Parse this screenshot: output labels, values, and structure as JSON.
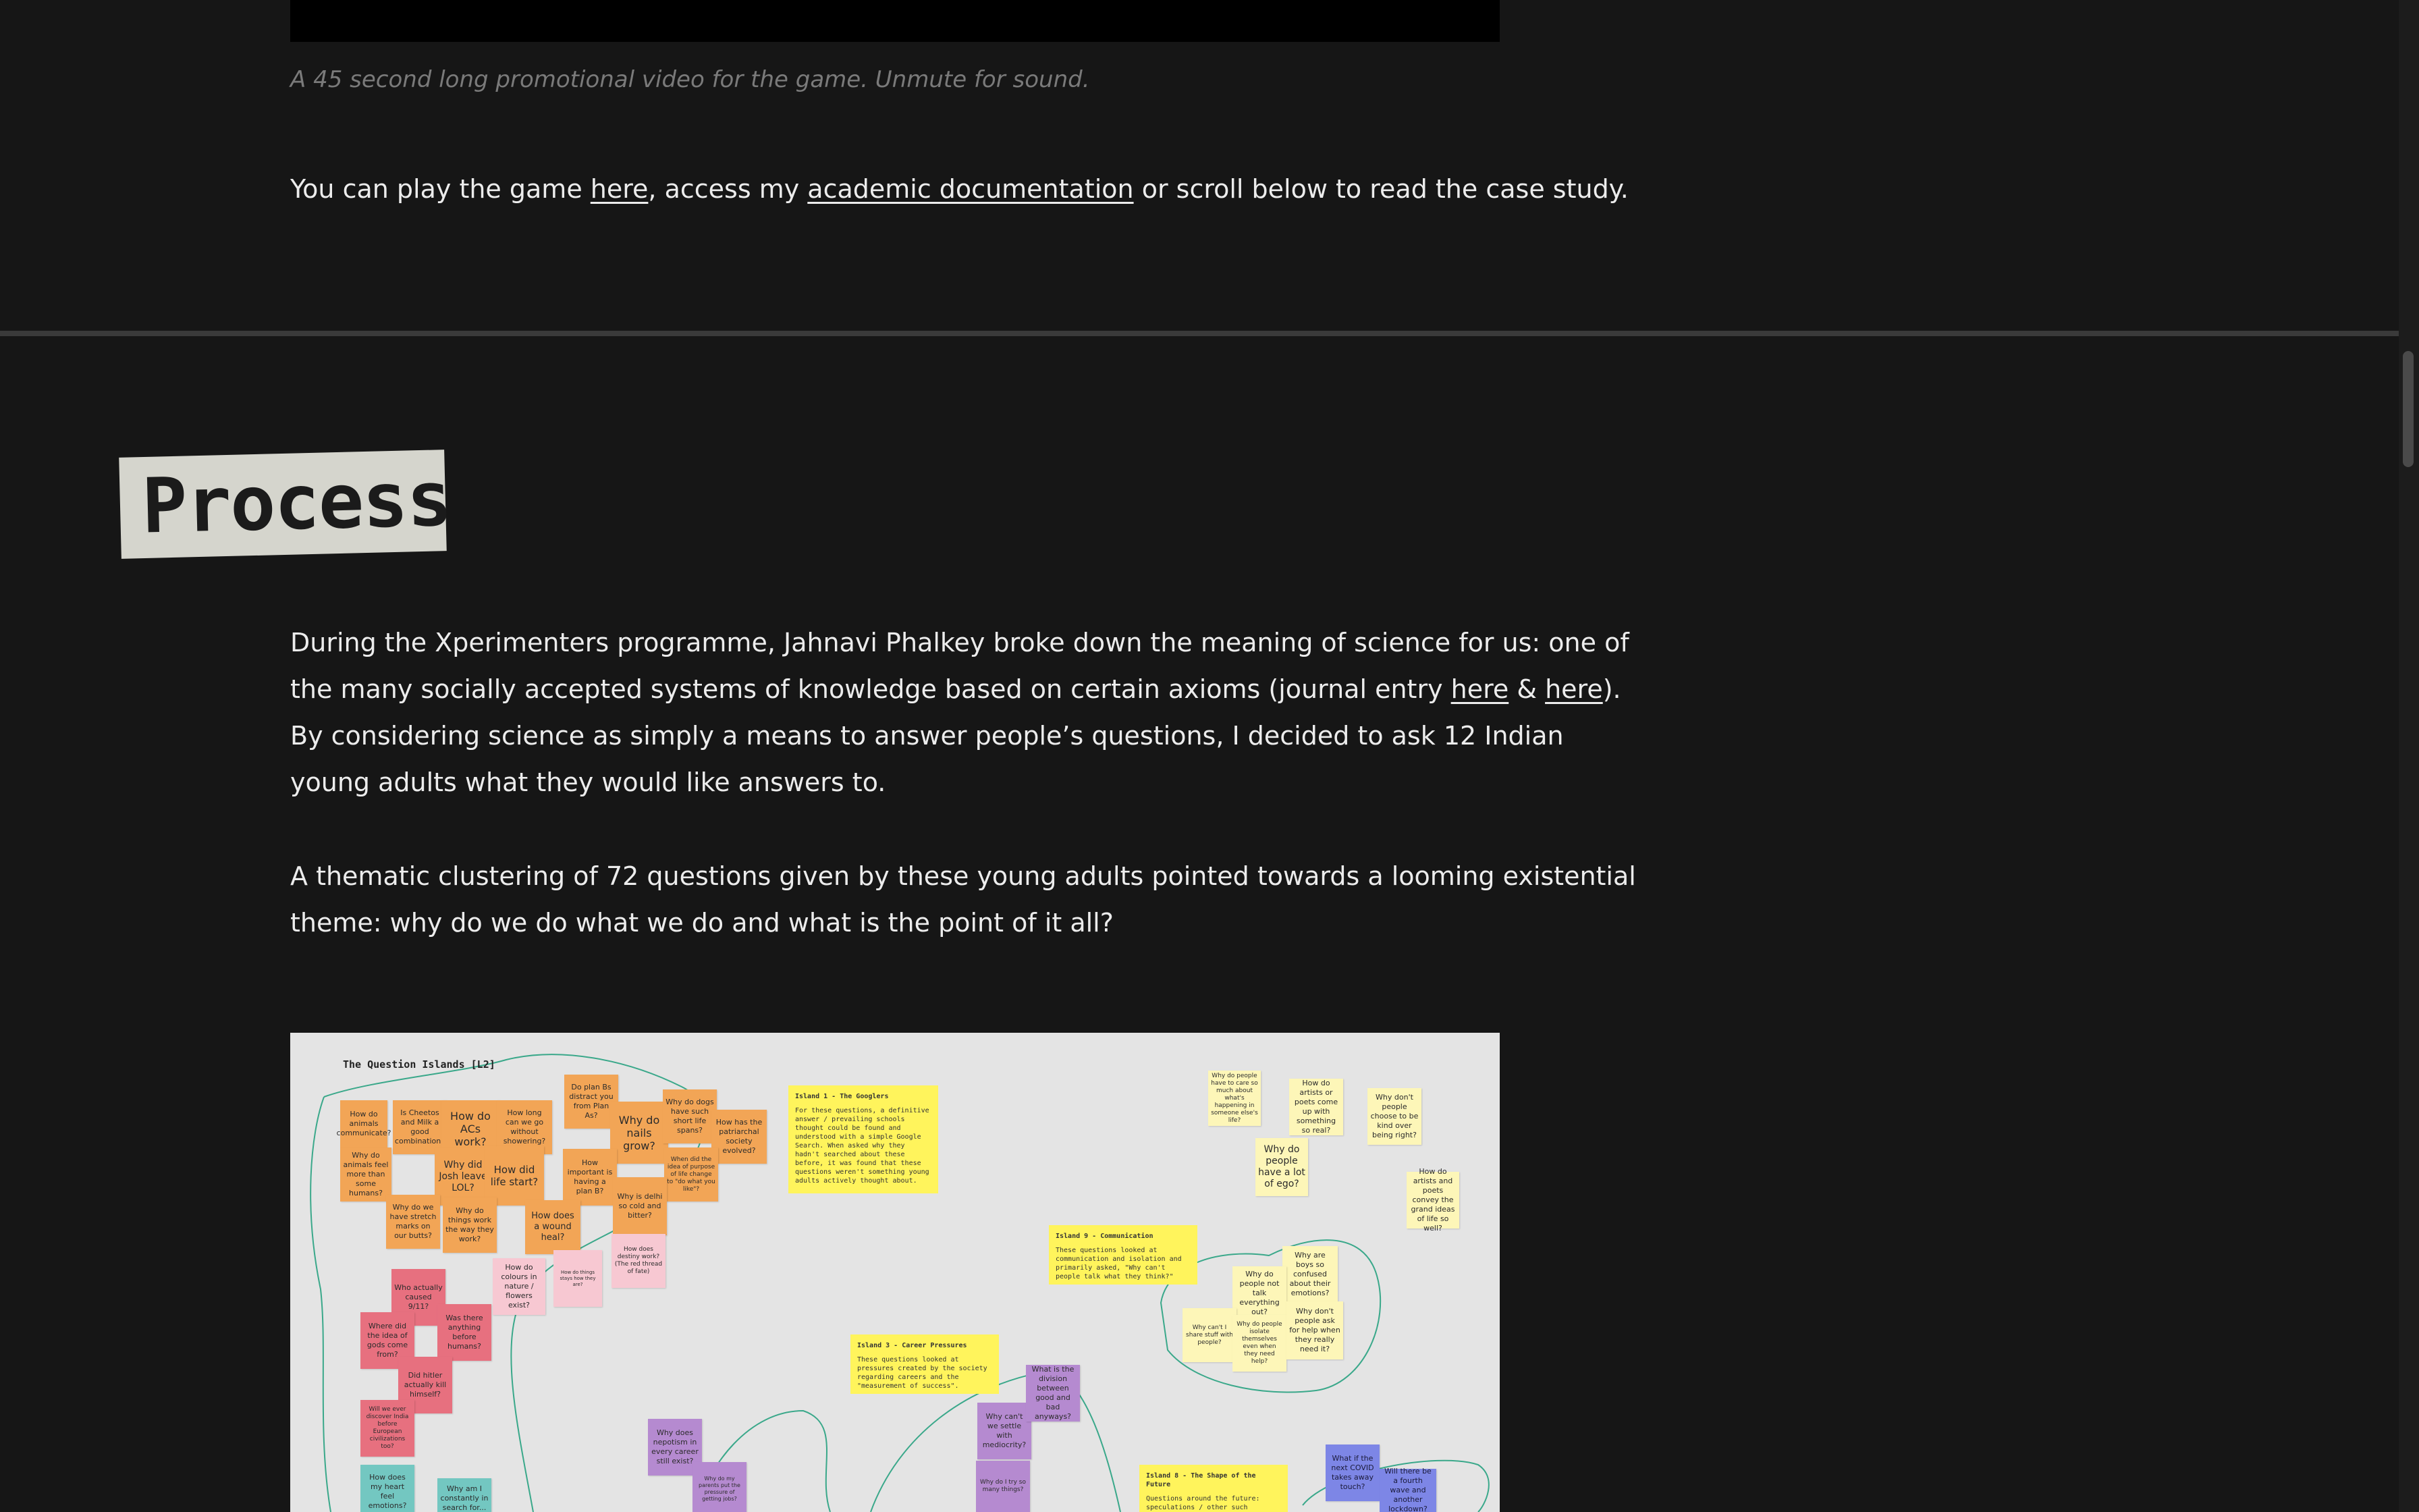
{
  "video": {
    "caption": "A 45 second long promotional video for the game. Unmute for sound."
  },
  "intro": {
    "before": "You can play the game ",
    "link1": "here",
    "middle": ", access my ",
    "link2": "academic documentation",
    "after": " or scroll below to read the case study."
  },
  "process": {
    "heading": "Process",
    "p1_a": "During the Xperimenters programme, Jahnavi Phalkey broke down the meaning of science for us: one of the many socially accepted systems of knowledge based on certain axioms (journal entry ",
    "p1_link1": "here",
    "p1_amp": " & ",
    "p1_link2": "here",
    "p1_b": "). By considering science as simply a means to answer people’s questions, I decided to ask 12 Indian young adults what they would like answers to.",
    "p2": "A thematic clustering of 72 questions given by these young adults pointed towards a looming existential theme: why do we do what we do and what is the point of it all?"
  },
  "board": {
    "title": "The Question Islands [L2]",
    "island1_title": "Island 1 - The Googlers",
    "island1_text": "For these questions, a definitive answer / prevailing schools thought could be found and understood with a simple Google Search. When asked why they hadn't searched about these before, it was found that these questions weren't something young adults actively thought about.",
    "island9_title": "Island 9 - Communication",
    "island9_text": "These questions looked at communication and isolation and primarily asked, \"Why can't people talk what they think?\"",
    "island3_title": "Island 3 - Career Pressures",
    "island3_text": "These questions looked at pressures created by the society regarding careers and the \"measurement of success\".",
    "island8_title": "Island 8 - The Shape of the Future",
    "island8_text": "Questions around the future: speculations / other such curiosity.",
    "notes": {
      "n1": "How do animals communicate?",
      "n2": "Is Cheetos and Milk a good combination?",
      "n3": "How do ACs work?",
      "n4": "How long can we go without showering?",
      "n5": "Do plan Bs distract you from Plan As?",
      "n6": "Why do nails grow?",
      "n7": "Why do dogs have such short life spans?",
      "n8": "How has the patriarchal society evolved?",
      "n9": "Why do animals feel more than some humans?",
      "n10": "Why did Josh leave LOL?",
      "n11": "How did life start?",
      "n12": "How important is having a plan B?",
      "n13": "When did the idea of purpose of life change to \"do what you like\"?",
      "n14": "Why do we have stretch marks on our butts?",
      "n15": "Why do things work the way they work?",
      "n16": "How does a wound heal?",
      "n17": "Why is delhi so cold and bitter?",
      "n18": "How does destiny work? (The red thread of fate)",
      "n19": "Who actually caused 9/11?",
      "n20": "How do colours in nature / flowers exist?",
      "n21": "How do things stays how they are?",
      "n22": "Where did the idea of gods come from?",
      "n23": "Was there anything before humans?",
      "n24": "Did hitler actually kill himself?",
      "n25": "Will we ever discover India before European civilizations too?",
      "n26": "How does my heart feel emotions?",
      "n27": "Why am I constantly in search for...",
      "n28": "Why does nepotism in every career still exist?",
      "n29": "Why do my parents put the pressure of getting jobs?",
      "n30": "Why can't we settle with mediocrity?",
      "n31": "What is the division between good and bad anyways?",
      "n32": "Why do I try so many things?",
      "n33": "Why do people have to care so much about what's happening in someone else's life?",
      "n34": "How do artists or poets come up with something so real?",
      "n35": "Why don't people choose to be kind over being right?",
      "n36": "Why do people have a lot of ego?",
      "n37": "How do artists and poets convey the grand ideas of life so well?",
      "n38": "Why are boys so confused about their emotions?",
      "n39": "Why do people not talk everything out?",
      "n40": "Why can't I share stuff with people?",
      "n41": "Why do people isolate themselves even when they need help?",
      "n42": "Why don't people ask for help when they really need it?",
      "n43": "What if the next COVID takes away touch?",
      "n44": "Will there be a fourth wave and another lockdown?"
    }
  },
  "colors": {
    "background": "#161616",
    "text": "#ececec",
    "muted": "#7a7a7a",
    "heading_bg": "#d5d5cd"
  }
}
